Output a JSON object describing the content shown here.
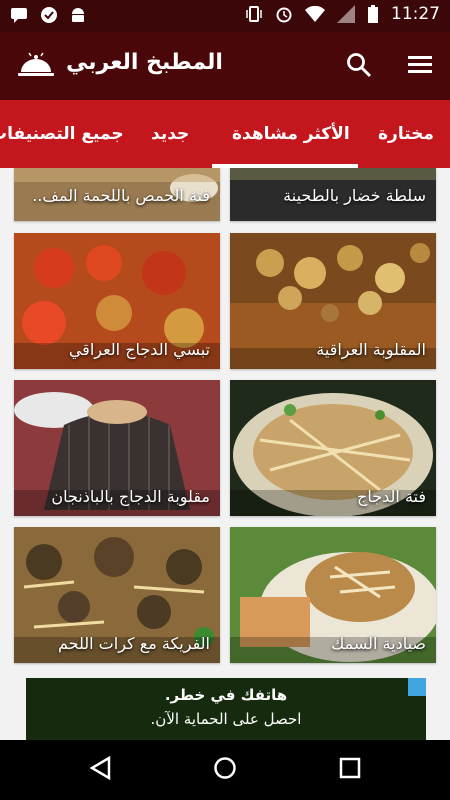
{
  "status": {
    "time": "11:27"
  },
  "app": {
    "title": "المطبخ العربي"
  },
  "tabs": [
    {
      "label": "مختارة"
    },
    {
      "label": "الأكثر مشاهدة",
      "active": true
    },
    {
      "label": "جديد"
    },
    {
      "label": "جميع التصنيفات"
    }
  ],
  "recipes": [
    {
      "title": "سلطة خضار بالطحينة"
    },
    {
      "title": "فتة الحمص باللحمة المف.."
    },
    {
      "title": "المقلوبة العراقية"
    },
    {
      "title": "تبسي الدجاج العراقي"
    },
    {
      "title": "فتة الدجاج"
    },
    {
      "title": "مقلوبة الدجاج بالباذنجان"
    },
    {
      "title": "صيادية السمك"
    },
    {
      "title": "الفريكة مع كرات اللحم"
    }
  ],
  "ad": {
    "line1": "هاتفك في خطر.",
    "line2": "احصل على الحماية الآن."
  },
  "colors": {
    "appbar": "#4a0709",
    "tabs": "#c4171d",
    "statusbar": "#3b0708"
  }
}
